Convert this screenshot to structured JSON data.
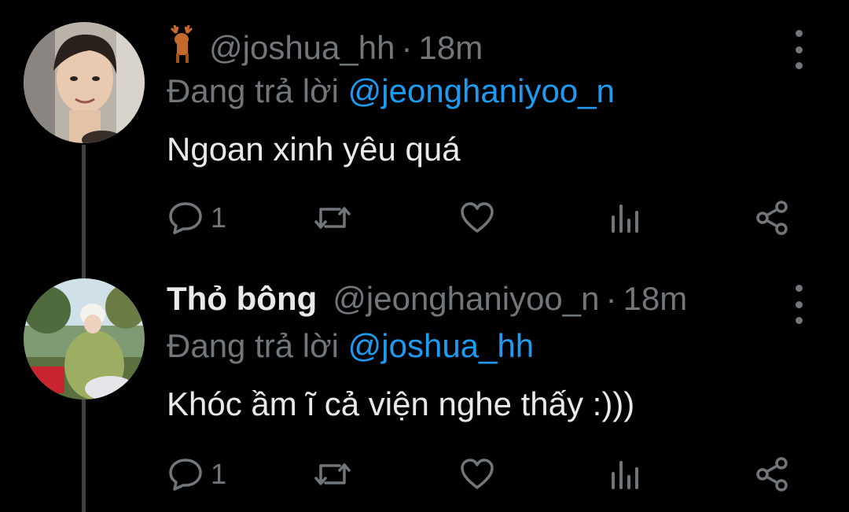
{
  "tweets": [
    {
      "badge_icon": "deer-emoji-icon",
      "display_name": "",
      "handle": "@joshua_hh",
      "separator": "·",
      "time": "18m",
      "reply_prefix": "Đang trả lời",
      "reply_to": "@jeonghaniyoo_n",
      "text": "Ngoan xinh yêu quá",
      "reply_count": "1"
    },
    {
      "display_name": "Thỏ bông",
      "handle": "@jeonghaniyoo_n",
      "separator": "·",
      "time": "18m",
      "reply_prefix": "Đang trả lời",
      "reply_to": "@joshua_hh",
      "text": "Khóc ầm ĩ cả viện nghe thấy :)))",
      "reply_count": "1"
    }
  ],
  "colors": {
    "background": "#000000",
    "text": "#e7e9ea",
    "muted": "#71767b",
    "link": "#1d9bf0",
    "thread_line": "#3e4144"
  }
}
